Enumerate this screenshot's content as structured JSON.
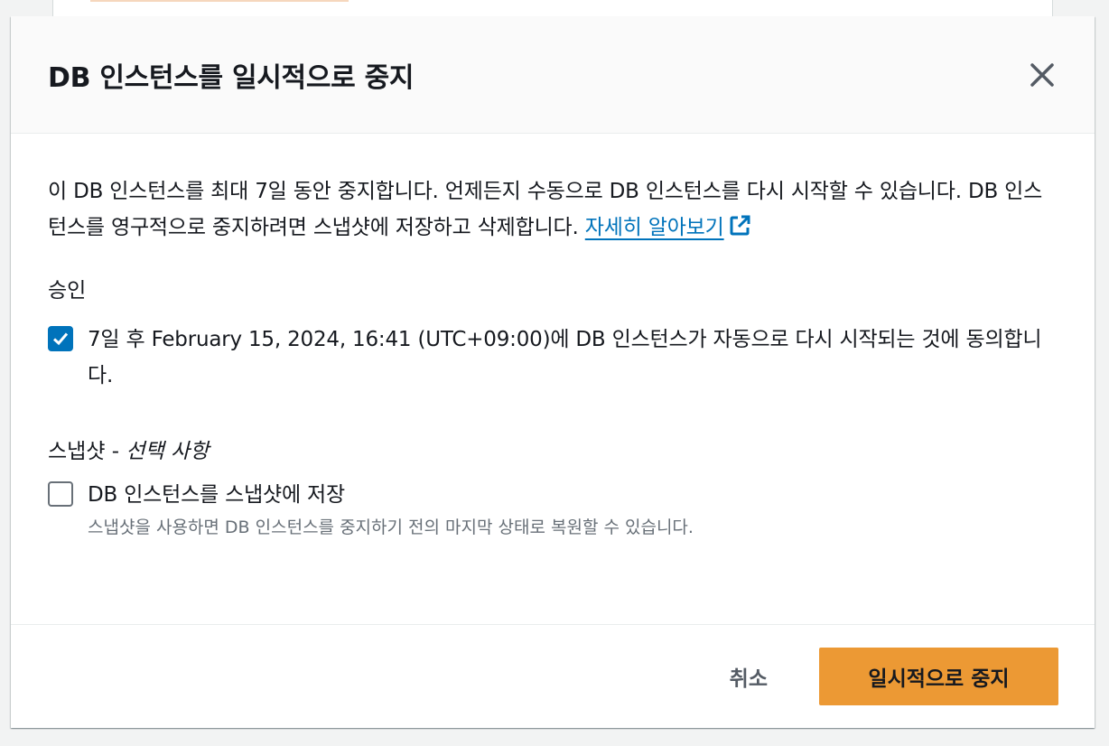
{
  "modal": {
    "title": "DB 인스턴스를 일시적으로 중지"
  },
  "description": {
    "text": "이 DB 인스턴스를 최대 7일 동안 중지합니다. 언제든지 수동으로 DB 인스턴스를 다시 시작할 수 있습니다. DB 인스턴스를 영구적으로 중지하려면 스냅샷에 저장하고 삭제합니다.",
    "learn_more_label": "자세히 알아보기"
  },
  "acknowledge": {
    "label": "승인",
    "checkbox_label": "7일 후 February 15, 2024, 16:41 (UTC+09:00)에 DB 인스턴스가 자동으로 다시 시작되는 것에 동의합니다.",
    "checked": true
  },
  "snapshot": {
    "label": "스냅샷 -",
    "optional_label": "선택 사항",
    "checkbox_label": "DB 인스턴스를 스냅샷에 저장",
    "checkbox_description": "스냅샷을 사용하면 DB 인스턴스를 중지하기 전의 마지막 상태로 복원할 수 있습니다.",
    "checked": false
  },
  "footer": {
    "cancel_label": "취소",
    "confirm_label": "일시적으로 중지"
  },
  "colors": {
    "primary_button": "#ec9934",
    "link": "#0073bb",
    "checkbox_checked": "#0073bb"
  }
}
